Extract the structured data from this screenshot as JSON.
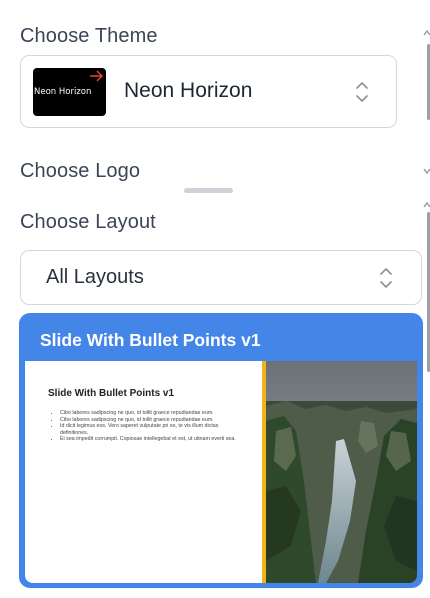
{
  "theme_section": {
    "label": "Choose Theme",
    "selected_name": "Neon Horizon",
    "thumbnail_text": "Neon Horizon"
  },
  "logo_section": {
    "label": "Choose Logo"
  },
  "layout_section": {
    "label": "Choose Layout",
    "selected_filter": "All Layouts"
  },
  "layout_card": {
    "title": "Slide With Bullet Points v1",
    "preview_title": "Slide With Bullet Points v1",
    "preview_bullets": [
      "Cibo labores sadipscing ne quo, id tollit graece repudiandae eum.",
      "Cibo labores sadipscing ne quo, id tollit graece repudiandae eum.",
      "Id dicit legimus eos. Vero saperet vulputate pri es, te vis illum dictas definitiones.",
      "Ei sea impedit corrumpit. Copiosae intellegebat et est, ut utinam everti sea."
    ]
  },
  "colors": {
    "card_accent": "#4485e8",
    "slide_divider": "#f2b21c",
    "theme_thumb_accent": "#e8472b"
  },
  "icons": {
    "select_chevrons": "chevron-up-down-icon",
    "thumb_spark": "spark-icon"
  }
}
